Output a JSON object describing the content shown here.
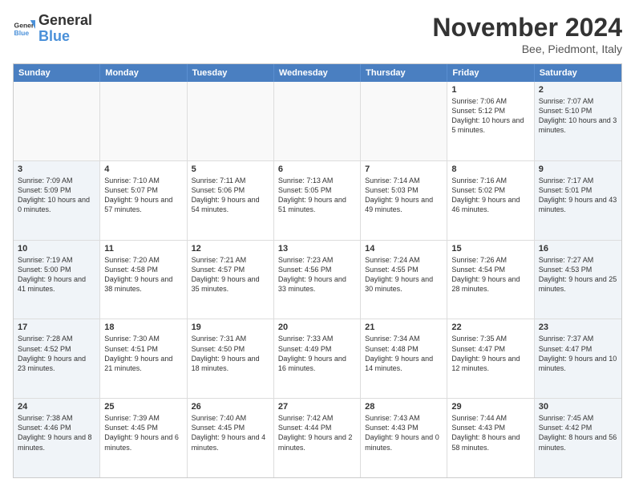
{
  "logo": {
    "line1": "General",
    "line2": "Blue"
  },
  "title": "November 2024",
  "location": "Bee, Piedmont, Italy",
  "days": [
    "Sunday",
    "Monday",
    "Tuesday",
    "Wednesday",
    "Thursday",
    "Friday",
    "Saturday"
  ],
  "rows": [
    [
      {
        "day": "",
        "info": ""
      },
      {
        "day": "",
        "info": ""
      },
      {
        "day": "",
        "info": ""
      },
      {
        "day": "",
        "info": ""
      },
      {
        "day": "",
        "info": ""
      },
      {
        "day": "1",
        "info": "Sunrise: 7:06 AM\nSunset: 5:12 PM\nDaylight: 10 hours\nand 5 minutes."
      },
      {
        "day": "2",
        "info": "Sunrise: 7:07 AM\nSunset: 5:10 PM\nDaylight: 10 hours\nand 3 minutes."
      }
    ],
    [
      {
        "day": "3",
        "info": "Sunrise: 7:09 AM\nSunset: 5:09 PM\nDaylight: 10 hours\nand 0 minutes."
      },
      {
        "day": "4",
        "info": "Sunrise: 7:10 AM\nSunset: 5:07 PM\nDaylight: 9 hours\nand 57 minutes."
      },
      {
        "day": "5",
        "info": "Sunrise: 7:11 AM\nSunset: 5:06 PM\nDaylight: 9 hours\nand 54 minutes."
      },
      {
        "day": "6",
        "info": "Sunrise: 7:13 AM\nSunset: 5:05 PM\nDaylight: 9 hours\nand 51 minutes."
      },
      {
        "day": "7",
        "info": "Sunrise: 7:14 AM\nSunset: 5:03 PM\nDaylight: 9 hours\nand 49 minutes."
      },
      {
        "day": "8",
        "info": "Sunrise: 7:16 AM\nSunset: 5:02 PM\nDaylight: 9 hours\nand 46 minutes."
      },
      {
        "day": "9",
        "info": "Sunrise: 7:17 AM\nSunset: 5:01 PM\nDaylight: 9 hours\nand 43 minutes."
      }
    ],
    [
      {
        "day": "10",
        "info": "Sunrise: 7:19 AM\nSunset: 5:00 PM\nDaylight: 9 hours\nand 41 minutes."
      },
      {
        "day": "11",
        "info": "Sunrise: 7:20 AM\nSunset: 4:58 PM\nDaylight: 9 hours\nand 38 minutes."
      },
      {
        "day": "12",
        "info": "Sunrise: 7:21 AM\nSunset: 4:57 PM\nDaylight: 9 hours\nand 35 minutes."
      },
      {
        "day": "13",
        "info": "Sunrise: 7:23 AM\nSunset: 4:56 PM\nDaylight: 9 hours\nand 33 minutes."
      },
      {
        "day": "14",
        "info": "Sunrise: 7:24 AM\nSunset: 4:55 PM\nDaylight: 9 hours\nand 30 minutes."
      },
      {
        "day": "15",
        "info": "Sunrise: 7:26 AM\nSunset: 4:54 PM\nDaylight: 9 hours\nand 28 minutes."
      },
      {
        "day": "16",
        "info": "Sunrise: 7:27 AM\nSunset: 4:53 PM\nDaylight: 9 hours\nand 25 minutes."
      }
    ],
    [
      {
        "day": "17",
        "info": "Sunrise: 7:28 AM\nSunset: 4:52 PM\nDaylight: 9 hours\nand 23 minutes."
      },
      {
        "day": "18",
        "info": "Sunrise: 7:30 AM\nSunset: 4:51 PM\nDaylight: 9 hours\nand 21 minutes."
      },
      {
        "day": "19",
        "info": "Sunrise: 7:31 AM\nSunset: 4:50 PM\nDaylight: 9 hours\nand 18 minutes."
      },
      {
        "day": "20",
        "info": "Sunrise: 7:33 AM\nSunset: 4:49 PM\nDaylight: 9 hours\nand 16 minutes."
      },
      {
        "day": "21",
        "info": "Sunrise: 7:34 AM\nSunset: 4:48 PM\nDaylight: 9 hours\nand 14 minutes."
      },
      {
        "day": "22",
        "info": "Sunrise: 7:35 AM\nSunset: 4:47 PM\nDaylight: 9 hours\nand 12 minutes."
      },
      {
        "day": "23",
        "info": "Sunrise: 7:37 AM\nSunset: 4:47 PM\nDaylight: 9 hours\nand 10 minutes."
      }
    ],
    [
      {
        "day": "24",
        "info": "Sunrise: 7:38 AM\nSunset: 4:46 PM\nDaylight: 9 hours\nand 8 minutes."
      },
      {
        "day": "25",
        "info": "Sunrise: 7:39 AM\nSunset: 4:45 PM\nDaylight: 9 hours\nand 6 minutes."
      },
      {
        "day": "26",
        "info": "Sunrise: 7:40 AM\nSunset: 4:45 PM\nDaylight: 9 hours\nand 4 minutes."
      },
      {
        "day": "27",
        "info": "Sunrise: 7:42 AM\nSunset: 4:44 PM\nDaylight: 9 hours\nand 2 minutes."
      },
      {
        "day": "28",
        "info": "Sunrise: 7:43 AM\nSunset: 4:43 PM\nDaylight: 9 hours\nand 0 minutes."
      },
      {
        "day": "29",
        "info": "Sunrise: 7:44 AM\nSunset: 4:43 PM\nDaylight: 8 hours\nand 58 minutes."
      },
      {
        "day": "30",
        "info": "Sunrise: 7:45 AM\nSunset: 4:42 PM\nDaylight: 8 hours\nand 56 minutes."
      }
    ]
  ]
}
